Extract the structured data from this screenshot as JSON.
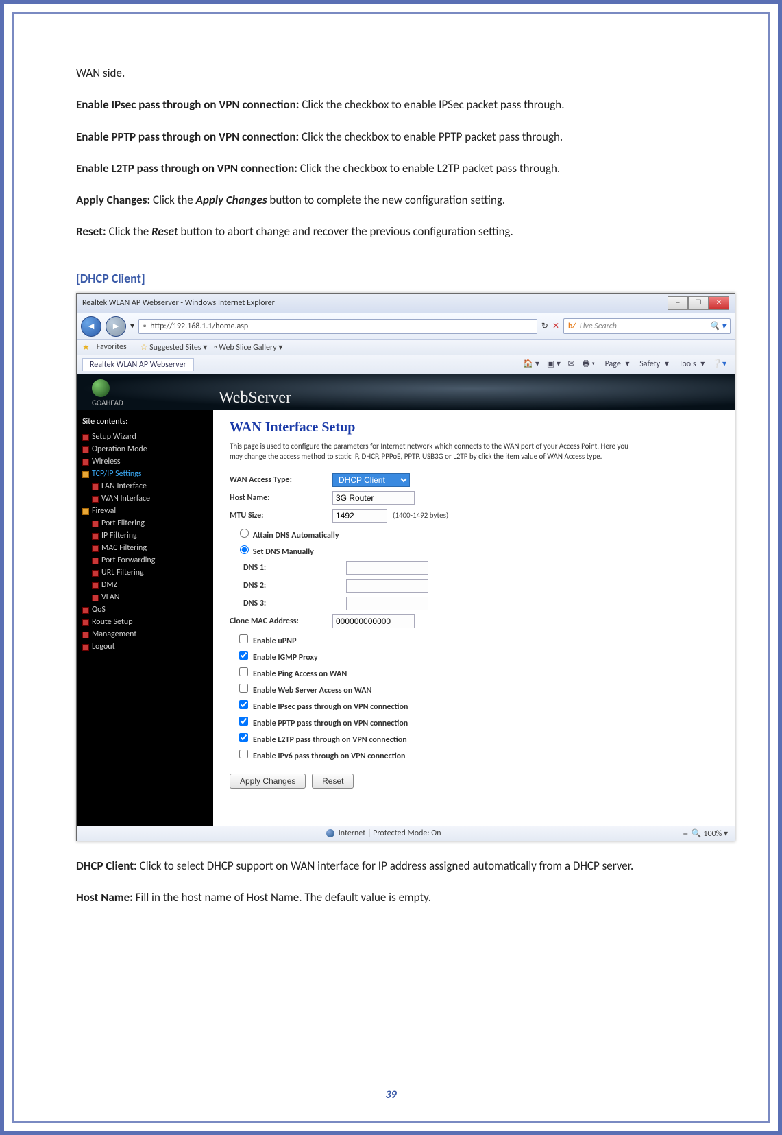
{
  "doc": {
    "p1_pre": "WAN side.",
    "p2_b": "Enable IPsec pass through on VPN connection:",
    "p2": " Click the checkbox to enable IPSec packet pass through.",
    "p3_b": "Enable PPTP pass through on VPN connection:",
    "p3": " Click the checkbox to enable PPTP packet pass through.",
    "p4_b": "Enable L2TP pass through on VPN connection:",
    "p4": " Click the checkbox to enable L2TP packet pass through.",
    "p5_b": "Apply Changes:",
    "p5a": " Click the ",
    "p5_bi": "Apply Changes",
    "p5b": " button to complete the new configuration setting.",
    "p6_b": "Reset:",
    "p6a": " Click the ",
    "p6_bi": "Reset",
    "p6b": " button to abort change and recover the previous configuration setting.",
    "heading": "[DHCP Client]",
    "p7_b": "DHCP Client:",
    "p7": " Click to select DHCP support on WAN interface for IP address assigned automatically from a DHCP server.",
    "p8_b": "Host Name:",
    "p8": " Fill in the host name of Host Name. The default value is empty.",
    "page_num": "39"
  },
  "ie": {
    "title": "Realtek WLAN AP Webserver - Windows Internet Explorer",
    "url": "http://192.168.1.1/home.asp",
    "search_placeholder": "Live Search",
    "fav_label": "Favorites",
    "fav_sites": "Suggested Sites",
    "fav_gallery": "Web Slice Gallery",
    "tab": "Realtek WLAN AP Webserver",
    "tool_page": "Page",
    "tool_safety": "Safety",
    "tool_tools": "Tools",
    "status_zone": "Internet | Protected Mode: On",
    "status_zoom": "100%"
  },
  "ws": {
    "brand": "GOAHEAD",
    "banner": "WebServer",
    "sidebar_hdr": "Site contents:",
    "nav": {
      "setup_wizard": "Setup Wizard",
      "op_mode": "Operation Mode",
      "wireless": "Wireless",
      "tcpip": "TCP/IP Settings",
      "lan": "LAN Interface",
      "wan": "WAN Interface",
      "firewall": "Firewall",
      "port_filtering": "Port Filtering",
      "ip_filtering": "IP Filtering",
      "mac_filtering": "MAC Filtering",
      "port_forwarding": "Port Forwarding",
      "url_filtering": "URL Filtering",
      "dmz": "DMZ",
      "vlan": "VLAN",
      "qos": "QoS",
      "route": "Route Setup",
      "mgmt": "Management",
      "logout": "Logout"
    },
    "main": {
      "title": "WAN Interface Setup",
      "desc": "This page is used to configure the parameters for Internet network which connects to the WAN port of your Access Point. Here you may change the access method to static IP, DHCP, PPPoE, PPTP, USB3G or L2TP by click the item value of WAN Access type.",
      "wan_access_lbl": "WAN Access Type:",
      "wan_access_val": "DHCP Client",
      "host_lbl": "Host Name:",
      "host_val": "3G Router",
      "mtu_lbl": "MTU Size:",
      "mtu_val": "1492",
      "mtu_hint": "(1400-1492 bytes)",
      "dns_auto": "Attain DNS Automatically",
      "dns_manual": "Set DNS Manually",
      "dns1_lbl": "DNS 1:",
      "dns2_lbl": "DNS 2:",
      "dns3_lbl": "DNS 3:",
      "clone_lbl": "Clone MAC Address:",
      "clone_val": "000000000000",
      "cb_upnp": "Enable uPNP",
      "cb_igmp": "Enable IGMP Proxy",
      "cb_ping": "Enable Ping Access on WAN",
      "cb_web": "Enable Web Server Access on WAN",
      "cb_ipsec": "Enable IPsec pass through on VPN connection",
      "cb_pptp": "Enable PPTP pass through on VPN connection",
      "cb_l2tp": "Enable L2TP pass through on VPN connection",
      "cb_ipv6": "Enable IPv6 pass through on VPN connection",
      "btn_apply": "Apply Changes",
      "btn_reset": "Reset"
    }
  }
}
